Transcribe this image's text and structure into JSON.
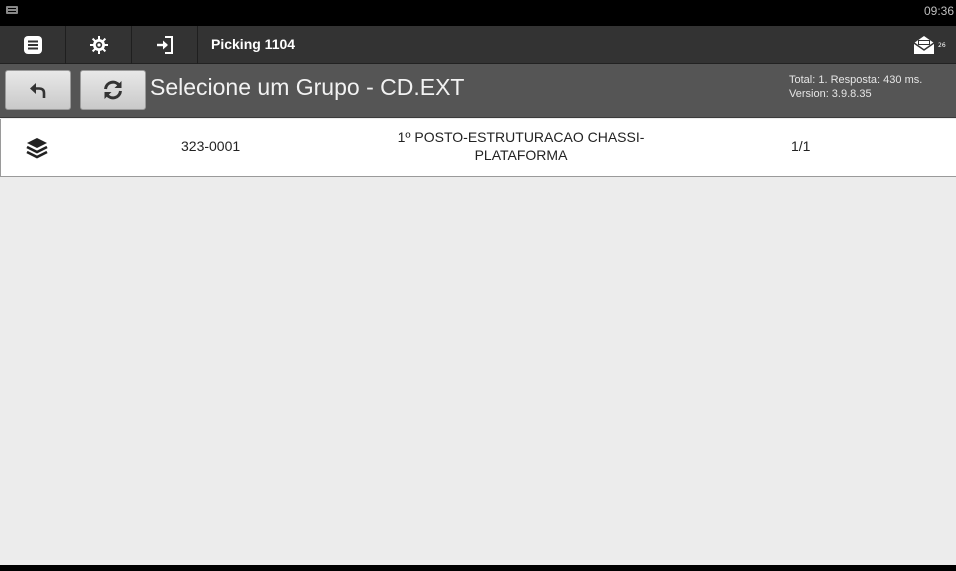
{
  "status_bar": {
    "time": "09:36"
  },
  "toolbar": {
    "title": "Picking 1104",
    "mail_badge": "26",
    "icons": [
      "list-icon",
      "gear-icon",
      "sign-in-icon",
      "mail-icon"
    ]
  },
  "header": {
    "title": "Selecione um Grupo - CD.EXT",
    "info_line1": "Total: 1. Resposta: 430 ms.",
    "info_line2": "Version: 3.9.8.35"
  },
  "rows": [
    {
      "icon": "layers-icon",
      "code": "323-0001",
      "description_line1": "1º POSTO-ESTRUTURACAO CHASSI-",
      "description_line2": "PLATAFORMA",
      "count": "1/1"
    }
  ],
  "colors": {
    "toolbar": "#333333",
    "subbar": "#555555",
    "background": "#ececec"
  }
}
